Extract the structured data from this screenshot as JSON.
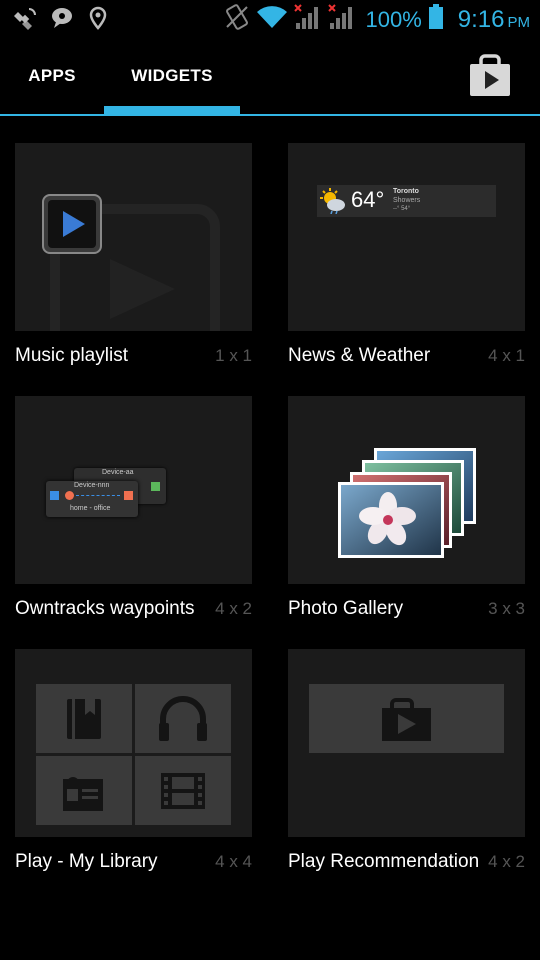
{
  "status_bar": {
    "battery_percent": "100%",
    "time": "9:16",
    "ampm": "PM",
    "icons": [
      "satellite-icon",
      "chat-bubble-icon",
      "location-pin-icon",
      "no-vibrate-icon",
      "wifi-icon",
      "signal-no-service-icon",
      "signal-no-service-icon",
      "battery-icon"
    ],
    "accent_color": "#33b5e5"
  },
  "tabs": [
    {
      "label": "APPS",
      "selected": false
    },
    {
      "label": "WIDGETS",
      "selected": true
    }
  ],
  "widgets": [
    {
      "name": "Music playlist",
      "dims": "1 x 1"
    },
    {
      "name": "News & Weather",
      "dims": "4 x 1",
      "preview": {
        "temp": "64°",
        "city": "Toronto",
        "condition": "Showers",
        "range": "--° 54°"
      }
    },
    {
      "name": "Owntracks waypoints",
      "dims": "4 x 2",
      "preview": {
        "back_label": "Device-aa",
        "front_label": "Device-nnn",
        "bottom_label": "home - office"
      }
    },
    {
      "name": "Photo Gallery",
      "dims": "3 x 3"
    },
    {
      "name": "Play - My Library",
      "dims": "4 x 4"
    },
    {
      "name": "Play Recommendations",
      "dims": "4 x 2"
    }
  ]
}
